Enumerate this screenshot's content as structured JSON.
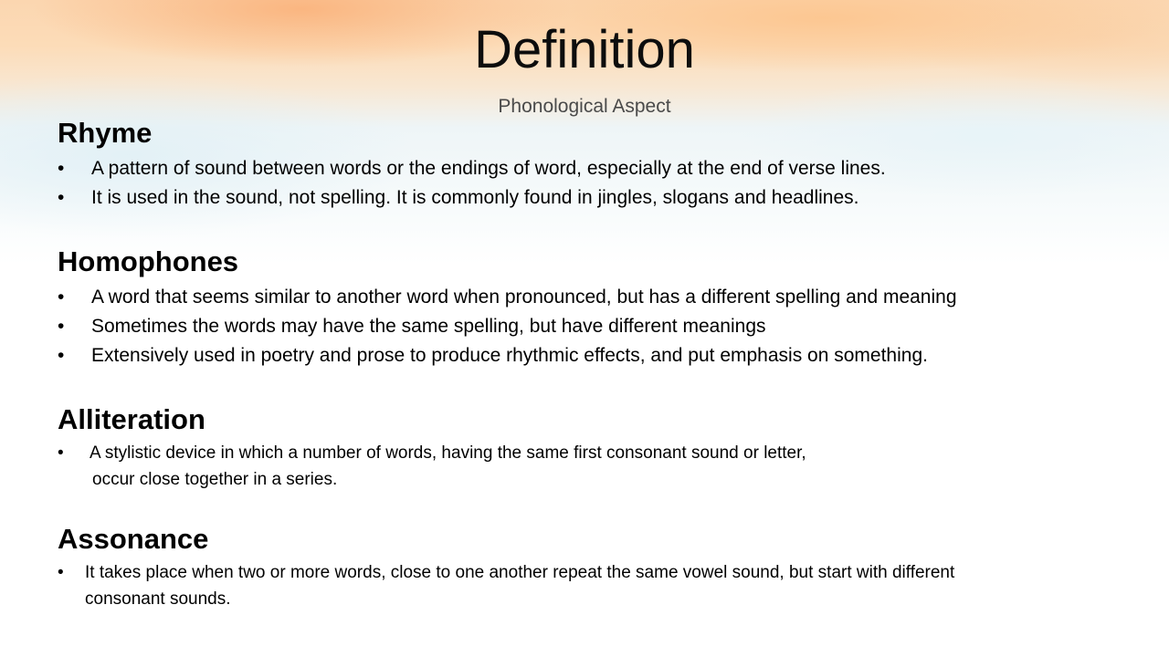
{
  "slide": {
    "title": "Definition",
    "subtitle": "Phonological Aspect",
    "bullet_char": "•",
    "sections": {
      "rhyme": {
        "heading": "Rhyme",
        "bullets": [
          "A pattern of sound between words or the endings of word, especially at the end of verse lines.",
          "It is used in the sound, not spelling. It is commonly found in jingles, slogans and headlines."
        ]
      },
      "homophones": {
        "heading": "Homophones",
        "bullets": [
          "A word that seems similar to another word when pronounced, but has a different spelling and meaning",
          "Sometimes the words may have the same spelling, but have different meanings",
          "Extensively used in poetry and prose to produce rhythmic effects, and put emphasis on something."
        ]
      },
      "alliteration": {
        "heading": "Alliteration",
        "bullet_lines": [
          "A stylistic device in which a number of words, having the same first consonant sound or letter,",
          "occur close together in a series."
        ]
      },
      "assonance": {
        "heading": "Assonance",
        "bullet_lines": [
          "It takes place when two or more words, close to one another repeat the same vowel sound, but start with different",
          "consonant sounds."
        ]
      }
    }
  }
}
